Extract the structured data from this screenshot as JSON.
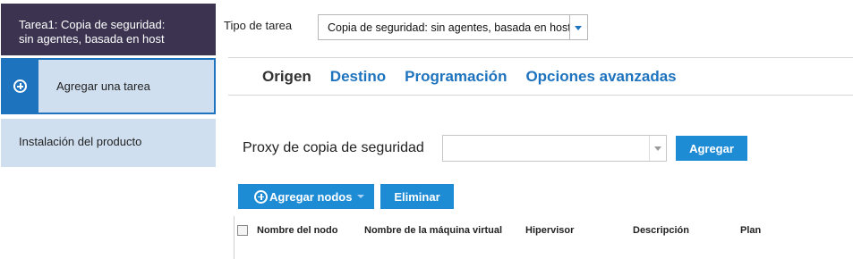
{
  "sidebar": {
    "task_header_line1": "Tarea1: Copia de seguridad:",
    "task_header_line2": "sin agentes, basada en host",
    "add_task": "Agregar una tarea",
    "install": "Instalación del producto"
  },
  "task_type": {
    "label": "Tipo de tarea",
    "value": "Copia de seguridad: sin agentes, basada en host"
  },
  "tabs": [
    "Origen",
    "Destino",
    "Programación",
    "Opciones avanzadas"
  ],
  "active_tab": "Origen",
  "proxy": {
    "label": "Proxy de copia de seguridad",
    "value": "",
    "add_button": "Agregar"
  },
  "nodes": {
    "add_nodes_button": "Agregar nodos",
    "delete_button": "Eliminar"
  },
  "table": {
    "columns": [
      "Nombre del nodo",
      "Nombre de la máquina virtual",
      "Hipervisor",
      "Descripción",
      "Plan"
    ]
  },
  "colors": {
    "header_bg": "#3b3350",
    "accent": "#1e73be",
    "button": "#1e8bd5",
    "panel": "#cfdff0"
  }
}
